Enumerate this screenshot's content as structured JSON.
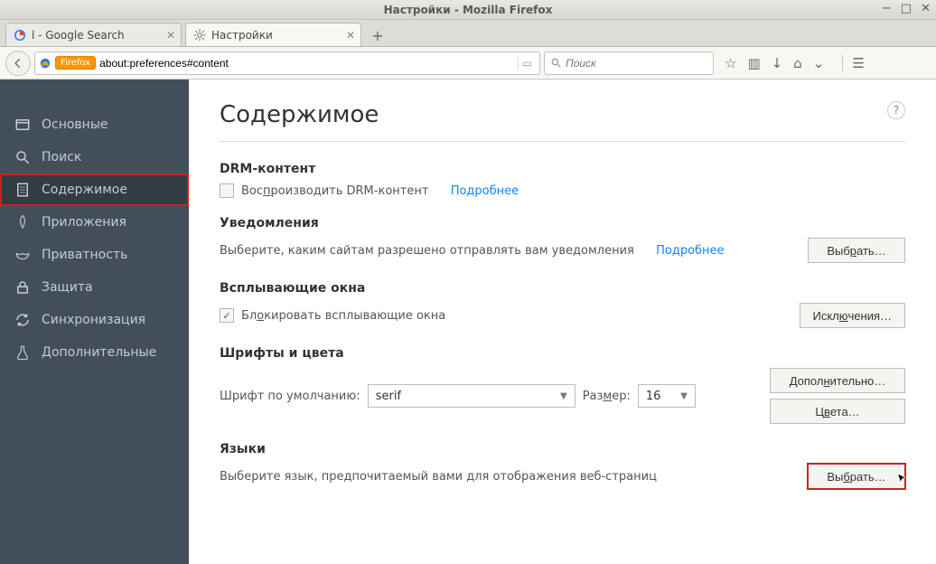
{
  "window": {
    "title": "Настройки - Mozilla Firefox"
  },
  "tabs": [
    {
      "label": "l - Google Search"
    },
    {
      "label": "Настройки"
    }
  ],
  "urlbar": {
    "brand": "Firefox",
    "url": "about:preferences#content"
  },
  "searchbar": {
    "placeholder": "Поиск"
  },
  "sidebar": {
    "items": [
      {
        "label": "Основные"
      },
      {
        "label": "Поиск"
      },
      {
        "label": "Содержимое"
      },
      {
        "label": "Приложения"
      },
      {
        "label": "Приватность"
      },
      {
        "label": "Защита"
      },
      {
        "label": "Синхронизация"
      },
      {
        "label": "Дополнительные"
      }
    ]
  },
  "page": {
    "title": "Содержимое",
    "drm": {
      "heading": "DRM-контент",
      "checkbox_label_pre": "Вос",
      "checkbox_label_u": "п",
      "checkbox_label_post": "роизводить DRM-контент",
      "more": "Подробнее"
    },
    "notifications": {
      "heading": "Уведомления",
      "desc": "Выберите, каким сайтам разрешено отправлять вам уведомления",
      "more": "Подробнее",
      "choose": "Выбрать…",
      "choose_u": "р"
    },
    "popups": {
      "heading": "Всплывающие окна",
      "checkbox_label_pre": "Бл",
      "checkbox_label_u": "о",
      "checkbox_label_post": "кировать всплывающие окна",
      "exceptions": "Исключения…",
      "exceptions_u": "ю"
    },
    "fonts": {
      "heading": "Шрифты и цвета",
      "default_font_label": "Шрифт по умолчанию:",
      "font_value": "serif",
      "size_label_pre": "Раз",
      "size_label_u": "м",
      "size_label_post": "ер:",
      "size_value": "16",
      "advanced": "Дополнительно…",
      "advanced_u": "н",
      "colors": "Цвета…",
      "colors_u": "в"
    },
    "languages": {
      "heading": "Языки",
      "desc": "Выберите язык, предпочитаемый вами для отображения веб-страниц",
      "choose": "Выбрать…",
      "choose_u": "б"
    }
  }
}
